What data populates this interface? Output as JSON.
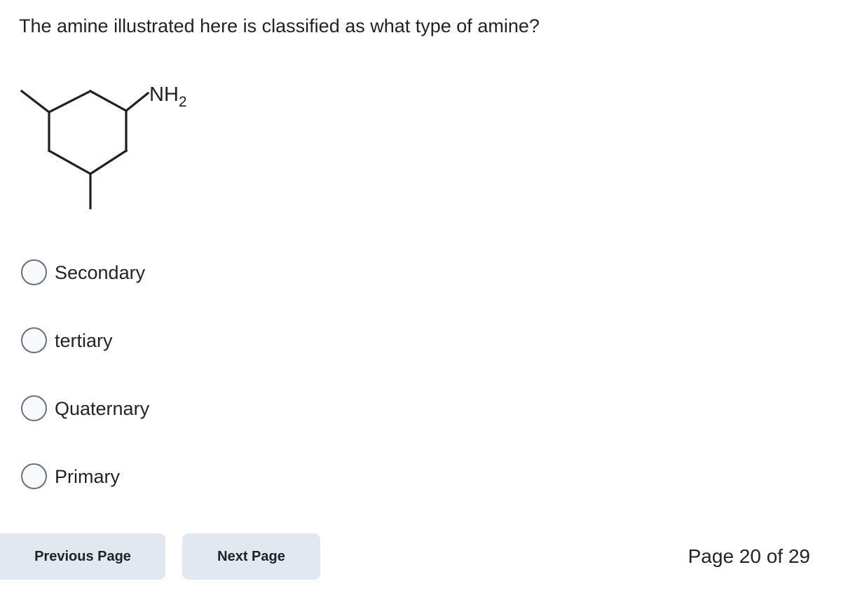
{
  "question": {
    "prompt": "The amine illustrated here is classified as what type of amine?"
  },
  "molecule": {
    "name": "3,5-dimethylcyclohexan-1-amine skeletal structure",
    "functional_group_label": "NH",
    "functional_group_subscript": "2",
    "stroke_color": "#231f20"
  },
  "answers": {
    "options": [
      {
        "label": "Secondary",
        "selected": false
      },
      {
        "label": "tertiary",
        "selected": false
      },
      {
        "label": "Quaternary",
        "selected": false
      },
      {
        "label": "Primary",
        "selected": false
      }
    ]
  },
  "footer": {
    "previous_label": "Previous Page",
    "next_label": "Next Page",
    "page_indicator": "Page 20 of 29",
    "button_color": "#e2e8f0"
  }
}
